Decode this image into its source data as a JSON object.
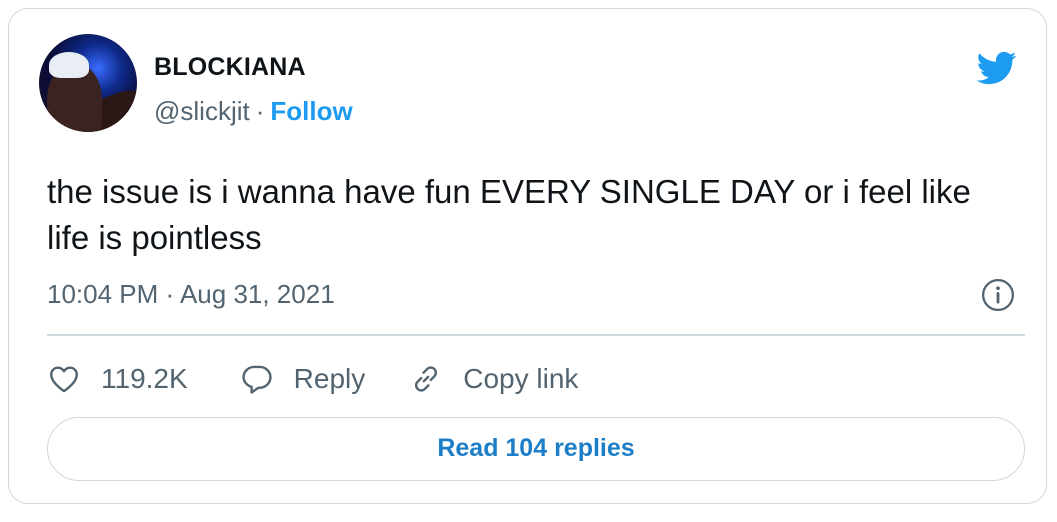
{
  "author": {
    "display_name": "BLOCKIANA",
    "handle": "@slickjit",
    "separator": "·",
    "follow_label": "Follow"
  },
  "tweet": {
    "text": "the issue is i wanna have fun EVERY SINGLE DAY or i feel like life is pointless",
    "timestamp": "10:04 PM · Aug 31, 2021"
  },
  "actions": {
    "like_count": "119.2K",
    "reply_label": "Reply",
    "copy_link_label": "Copy link"
  },
  "read_replies_label": "Read 104 replies",
  "icons": [
    "twitter-bird-icon",
    "info-icon",
    "heart-icon",
    "reply-bubble-icon",
    "link-icon"
  ],
  "colors": {
    "accent": "#1d9bf0",
    "muted": "#536471",
    "text": "#0f1419",
    "border": "#cfd9de"
  }
}
